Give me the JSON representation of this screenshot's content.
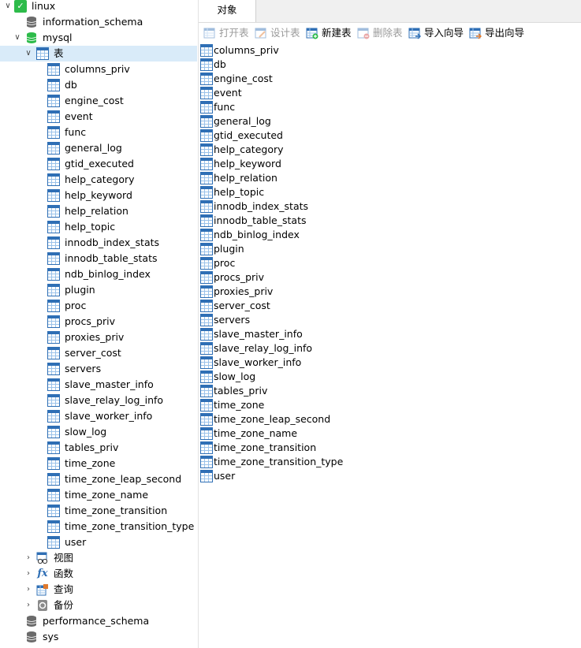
{
  "tree": {
    "connection": "linux",
    "databases_top": [
      "information_schema"
    ],
    "open_db": "mysql",
    "tables_node": "表",
    "tables": [
      "columns_priv",
      "db",
      "engine_cost",
      "event",
      "func",
      "general_log",
      "gtid_executed",
      "help_category",
      "help_keyword",
      "help_relation",
      "help_topic",
      "innodb_index_stats",
      "innodb_table_stats",
      "ndb_binlog_index",
      "plugin",
      "proc",
      "procs_priv",
      "proxies_priv",
      "server_cost",
      "servers",
      "slave_master_info",
      "slave_relay_log_info",
      "slave_worker_info",
      "slow_log",
      "tables_priv",
      "time_zone",
      "time_zone_leap_second",
      "time_zone_name",
      "time_zone_transition",
      "time_zone_transition_type",
      "user"
    ],
    "views_node": "视图",
    "functions_node": "函数",
    "queries_node": "查询",
    "backups_node": "备份",
    "databases_bottom": [
      "performance_schema",
      "sys"
    ]
  },
  "tabs": {
    "objects": "对象"
  },
  "toolbar": {
    "open_table": "打开表",
    "design_table": "设计表",
    "new_table": "新建表",
    "delete_table": "删除表",
    "import_wizard": "导入向导",
    "export_wizard": "导出向导"
  },
  "objects": [
    "columns_priv",
    "db",
    "engine_cost",
    "event",
    "func",
    "general_log",
    "gtid_executed",
    "help_category",
    "help_keyword",
    "help_relation",
    "help_topic",
    "innodb_index_stats",
    "innodb_table_stats",
    "ndb_binlog_index",
    "plugin",
    "proc",
    "procs_priv",
    "proxies_priv",
    "server_cost",
    "servers",
    "slave_master_info",
    "slave_relay_log_info",
    "slave_worker_info",
    "slow_log",
    "tables_priv",
    "time_zone",
    "time_zone_leap_second",
    "time_zone_name",
    "time_zone_transition",
    "time_zone_transition_type",
    "user"
  ],
  "colors": {
    "selection": "#d9ebf9",
    "table_icon": "#2f6fb5",
    "connection_icon": "#2dbb4a",
    "db_active": "#2dbb4a",
    "db_inactive": "#6b6b6b"
  }
}
